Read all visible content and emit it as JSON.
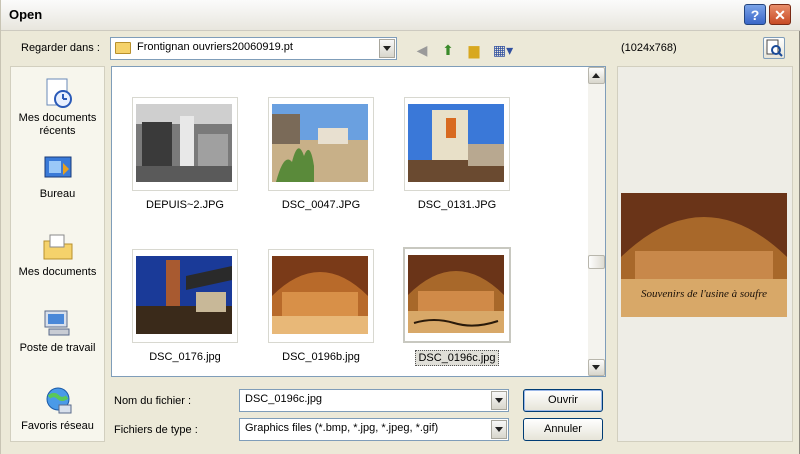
{
  "window": {
    "title": "Open"
  },
  "toolbar": {
    "look_in_label": "Regarder dans :",
    "look_in_value": "Frontignan ouvriers20060919.pt",
    "icons": [
      "back-icon",
      "up-folder-icon",
      "new-folder-icon",
      "view-menu-icon"
    ]
  },
  "places": [
    {
      "label": "Mes documents récents",
      "icon": "recent-documents-icon"
    },
    {
      "label": "Bureau",
      "icon": "desktop-icon"
    },
    {
      "label": "Mes documents",
      "icon": "my-documents-icon"
    },
    {
      "label": "Poste de travail",
      "icon": "my-computer-icon"
    },
    {
      "label": "Favoris réseau",
      "icon": "network-places-icon"
    }
  ],
  "files": [
    {
      "name": "DEPUIS~2.JPG",
      "selected": false
    },
    {
      "name": "DSC_0047.JPG",
      "selected": false
    },
    {
      "name": "DSC_0131.JPG",
      "selected": false
    },
    {
      "name": "DSC_0176.jpg",
      "selected": false
    },
    {
      "name": "DSC_0196b.jpg",
      "selected": false
    },
    {
      "name": "DSC_0196c.jpg",
      "selected": true
    }
  ],
  "filename": {
    "label": "Nom du fichier :",
    "value": "DSC_0196c.jpg"
  },
  "filetype": {
    "label": "Fichiers de type :",
    "value": "Graphics files (*.bmp, *.jpg, *.jpeg, *.gif)"
  },
  "buttons": {
    "open": "Ouvrir",
    "cancel": "Annuler"
  },
  "preview": {
    "resolution": "(1024x768)",
    "caption": "Souvenirs de l'usine à soufre"
  },
  "colors": {
    "dialog_bg": "#ece9d8",
    "selection_border": "#c8c8c0",
    "accent": "#003c74"
  }
}
